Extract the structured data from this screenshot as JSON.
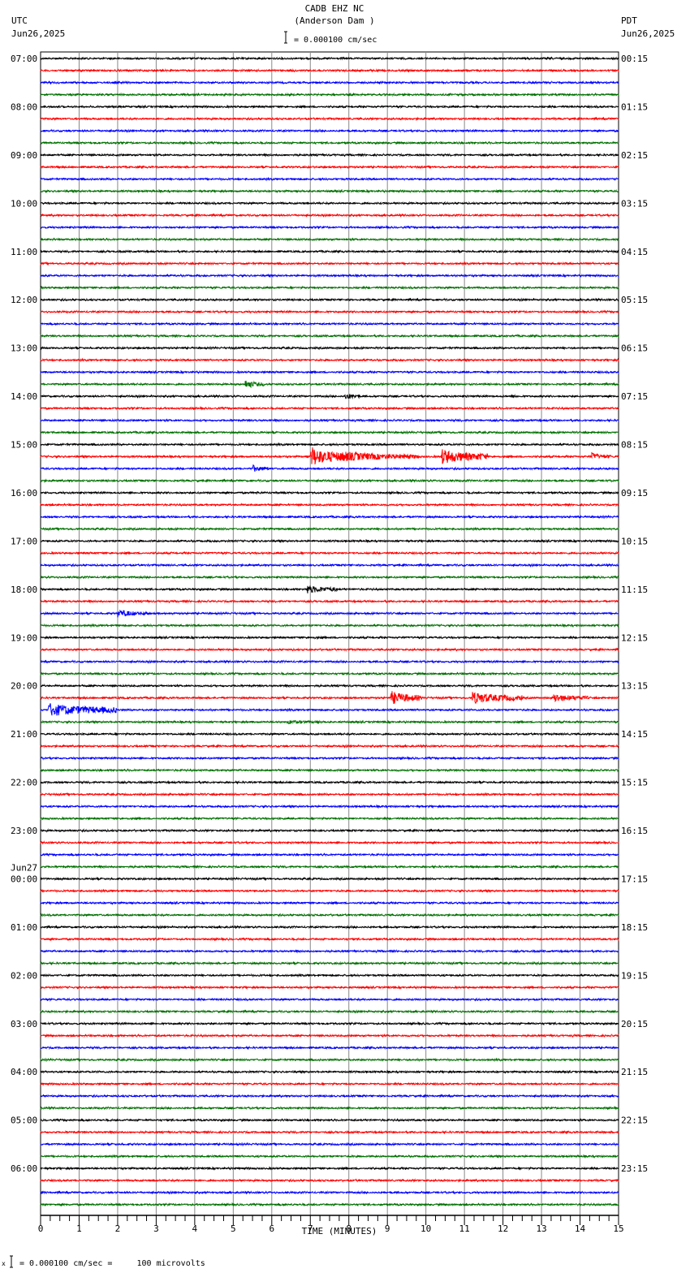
{
  "header": {
    "title": "CADB EHZ NC",
    "subtitle": "(Anderson Dam )",
    "left_tz": "UTC",
    "left_date": "Jun26,2025",
    "right_tz": "PDT",
    "right_date": "Jun26,2025",
    "scale_text": "= 0.000100 cm/sec"
  },
  "footer": {
    "scale_text": "= 0.000100 cm/sec =     100 microvolts",
    "marker": "x"
  },
  "chart_data": {
    "type": "line",
    "title": "CADB EHZ NC (Anderson Dam )",
    "xlabel": "TIME (MINUTES)",
    "xlim": [
      0,
      15
    ],
    "xticks": [
      "0",
      "1",
      "2",
      "3",
      "4",
      "5",
      "6",
      "7",
      "8",
      "9",
      "10",
      "11",
      "12",
      "13",
      "14",
      "15"
    ],
    "minutes_per_trace": 15,
    "trace_count": 96,
    "trace_colors": [
      "#000000",
      "#ff0000",
      "#0000ff",
      "#007000"
    ],
    "left_labels": [
      "07:00",
      "08:00",
      "09:00",
      "10:00",
      "11:00",
      "12:00",
      "13:00",
      "14:00",
      "15:00",
      "16:00",
      "17:00",
      "18:00",
      "19:00",
      "20:00",
      "21:00",
      "22:00",
      "23:00",
      "00:00",
      "01:00",
      "02:00",
      "03:00",
      "04:00",
      "05:00",
      "06:00"
    ],
    "date_change_label": "Jun27",
    "date_change_index": 17,
    "right_labels": [
      "00:15",
      "01:15",
      "02:15",
      "03:15",
      "04:15",
      "05:15",
      "06:15",
      "07:15",
      "08:15",
      "09:15",
      "10:15",
      "11:15",
      "12:15",
      "13:15",
      "14:15",
      "15:15",
      "16:15",
      "17:15",
      "18:15",
      "19:15",
      "20:15",
      "21:15",
      "22:15",
      "23:15"
    ],
    "events": [
      {
        "trace": 27,
        "start": 5.3,
        "end": 5.8,
        "amplitude": 6
      },
      {
        "trace": 28,
        "start": 7.9,
        "end": 8.3,
        "amplitude": 5
      },
      {
        "trace": 28,
        "start": 12.2,
        "end": 12.8,
        "amplitude": 2
      },
      {
        "trace": 33,
        "start": 7.0,
        "end": 7.8,
        "amplitude": 14
      },
      {
        "trace": 33,
        "start": 7.8,
        "end": 9.8,
        "amplitude": 7
      },
      {
        "trace": 33,
        "start": 10.4,
        "end": 11.6,
        "amplitude": 10
      },
      {
        "trace": 33,
        "start": 14.3,
        "end": 14.8,
        "amplitude": 5
      },
      {
        "trace": 34,
        "start": 5.5,
        "end": 5.9,
        "amplitude": 5
      },
      {
        "trace": 36,
        "start": 5.6,
        "end": 5.9,
        "amplitude": 2
      },
      {
        "trace": 44,
        "start": 6.9,
        "end": 7.7,
        "amplitude": 6
      },
      {
        "trace": 46,
        "start": 2.0,
        "end": 2.8,
        "amplitude": 5
      },
      {
        "trace": 48,
        "start": 7.0,
        "end": 7.5,
        "amplitude": 2
      },
      {
        "trace": 53,
        "start": 9.1,
        "end": 9.9,
        "amplitude": 9
      },
      {
        "trace": 53,
        "start": 11.2,
        "end": 12.5,
        "amplitude": 8
      },
      {
        "trace": 53,
        "start": 13.3,
        "end": 14.2,
        "amplitude": 6
      },
      {
        "trace": 54,
        "start": 0.2,
        "end": 2.0,
        "amplitude": 9
      },
      {
        "trace": 55,
        "start": 6.4,
        "end": 7.3,
        "amplitude": 3
      }
    ]
  }
}
